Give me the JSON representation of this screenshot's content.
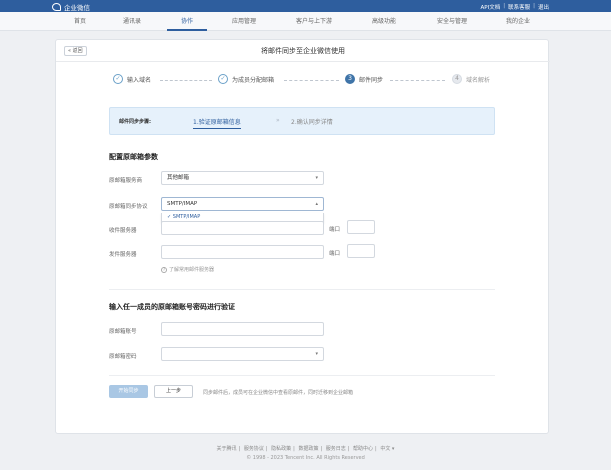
{
  "topbar": {
    "app_name": "企业微信",
    "links": [
      "API文档",
      "联系客服",
      "退出"
    ],
    "separator": "|"
  },
  "nav": {
    "items": [
      "首页",
      "通讯录",
      "协作",
      "应用管理",
      "客户与上下游",
      "高级功能",
      "安全与管理",
      "我的企业"
    ],
    "active_index": 2
  },
  "page": {
    "back_label": "« 返回",
    "title": "将邮件同步至企业微信使用"
  },
  "steps": [
    {
      "num": "✓",
      "label": "输入域名",
      "state": "done"
    },
    {
      "num": "✓",
      "label": "为成员分配邮箱",
      "state": "done"
    },
    {
      "num": "3",
      "label": "邮件同步",
      "state": "current"
    },
    {
      "num": "4",
      "label": "域名解析",
      "state": "pending"
    }
  ],
  "strip": {
    "label": "邮件同步步骤:",
    "step1": "1.验证原邮箱信息",
    "arrow": "»",
    "step2": "2.确认同步详情"
  },
  "config": {
    "title": "配置原邮箱参数",
    "provider_label": "原邮箱服务商",
    "provider_value": "其他邮箱",
    "protocol_label": "原邮箱同步协议",
    "protocol_value": "SMTP/IMAP",
    "protocol_option": "✓ SMTP/IMAP",
    "incoming_label": "收件服务器",
    "outgoing_label": "发件服务器",
    "port_label": "端口",
    "hint": "了解常用邮件服务器"
  },
  "verify": {
    "title": "输入任一成员的原邮箱账号密码进行验证",
    "account_label": "原邮箱账号",
    "password_label": "原邮箱密码"
  },
  "actions": {
    "primary": "开始同步",
    "prev": "上一步",
    "note": "同步邮件后，成员可在企业微信中查看原邮件，同时迁移到企业邮箱"
  },
  "footer": {
    "links": [
      "关于腾讯",
      "服务协议",
      "隐私政策",
      "数据政策",
      "服务日志",
      "帮助中心",
      "中文 ▾"
    ],
    "copyright": "© 1998 - 2023 Tencent Inc. All Rights Reserved"
  },
  "colors": {
    "brand": "#2e5e9e",
    "strip_bg": "#e6f1fb",
    "primary_disabled": "#a9c7e4"
  }
}
